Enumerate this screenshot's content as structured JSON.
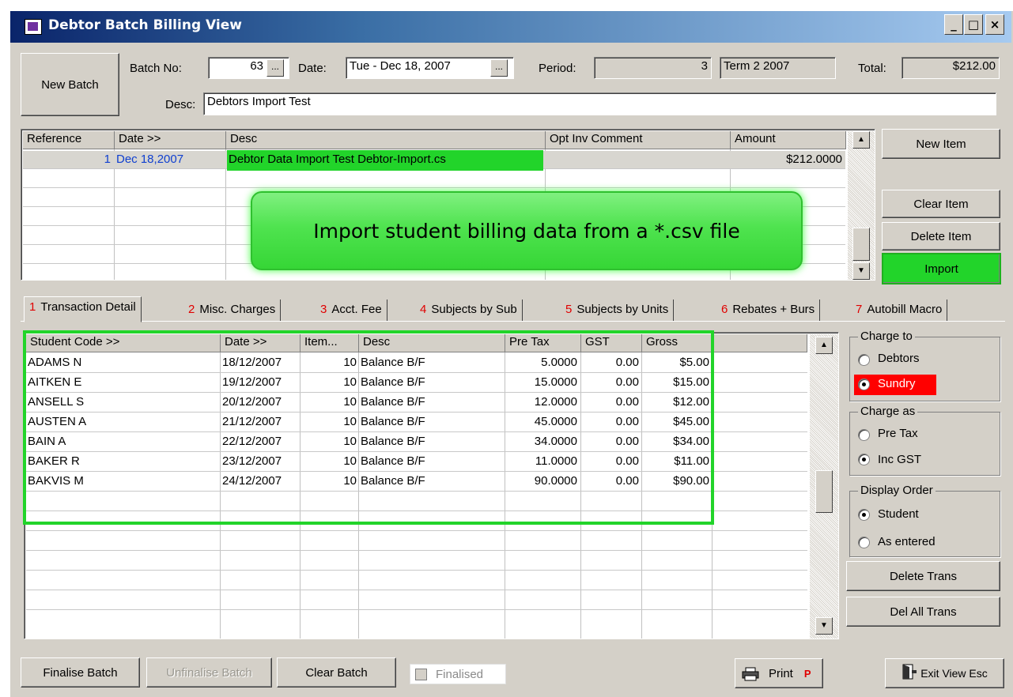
{
  "window": {
    "title": "Debtor Batch Billing View",
    "controls": {
      "minimize": "_",
      "maximize": "□",
      "close": "×"
    }
  },
  "header": {
    "new_batch_label": "New Batch",
    "batch_no_label": "Batch No:",
    "batch_no_value": "63",
    "ellipsis": "...",
    "date_label": "Date:",
    "date_value": "Tue - Dec 18, 2007",
    "period_label": "Period:",
    "period_value": "3",
    "term_value": "Term 2 2007",
    "total_label": "Total:",
    "total_value": "$212.00",
    "desc_label": "Desc:",
    "desc_value": "Debtors Import Test"
  },
  "items_grid": {
    "columns": [
      "Reference",
      "Date >>",
      "Desc",
      "Opt Inv Comment",
      "Amount"
    ],
    "rows": [
      {
        "reference": "1",
        "date": "Dec 18,2007",
        "desc": "Debtor Data Import Test Debtor-Import.cs",
        "comment": "",
        "amount": "$212.0000"
      }
    ]
  },
  "item_buttons": {
    "new_item": "New Item",
    "clear_item": "Clear Item",
    "delete_item": "Delete Item",
    "import": "Import"
  },
  "callout": "Import student billing data from a *.csv file",
  "tabs": [
    {
      "num": "1",
      "label": "Transaction Detail"
    },
    {
      "num": "2",
      "label": "Misc. Charges"
    },
    {
      "num": "3",
      "label": "Acct. Fee"
    },
    {
      "num": "4",
      "label": "Subjects by Sub"
    },
    {
      "num": "5",
      "label": "Subjects by Units"
    },
    {
      "num": "6",
      "label": "Rebates + Burs"
    },
    {
      "num": "7",
      "label": "Autobill Macro"
    }
  ],
  "trans_grid": {
    "columns": [
      "Student Code >>",
      "Date >>",
      "Item...",
      "Desc",
      "Pre Tax",
      "GST",
      "Gross"
    ],
    "rows": [
      {
        "code": "ADAMS N",
        "date": "18/12/2007",
        "item": "10",
        "desc": "Balance B/F",
        "pretax": "5.0000",
        "gst": "0.00",
        "gross": "$5.00"
      },
      {
        "code": "AITKEN E",
        "date": "19/12/2007",
        "item": "10",
        "desc": "Balance B/F",
        "pretax": "15.0000",
        "gst": "0.00",
        "gross": "$15.00"
      },
      {
        "code": "ANSELL S",
        "date": "20/12/2007",
        "item": "10",
        "desc": "Balance B/F",
        "pretax": "12.0000",
        "gst": "0.00",
        "gross": "$12.00"
      },
      {
        "code": "AUSTEN A",
        "date": "21/12/2007",
        "item": "10",
        "desc": "Balance B/F",
        "pretax": "45.0000",
        "gst": "0.00",
        "gross": "$45.00"
      },
      {
        "code": "BAIN A",
        "date": "22/12/2007",
        "item": "10",
        "desc": "Balance B/F",
        "pretax": "34.0000",
        "gst": "0.00",
        "gross": "$34.00"
      },
      {
        "code": "BAKER R",
        "date": "23/12/2007",
        "item": "10",
        "desc": "Balance B/F",
        "pretax": "11.0000",
        "gst": "0.00",
        "gross": "$11.00"
      },
      {
        "code": "BAKVIS M",
        "date": "24/12/2007",
        "item": "10",
        "desc": "Balance B/F",
        "pretax": "90.0000",
        "gst": "0.00",
        "gross": "$90.00"
      }
    ]
  },
  "options": {
    "charge_to": {
      "title": "Charge to",
      "debtors": "Debtors",
      "sundry": "Sundry",
      "selected": "Sundry"
    },
    "charge_as": {
      "title": "Charge as",
      "pre_tax": "Pre Tax",
      "inc_gst": "Inc GST",
      "selected": "Inc GST"
    },
    "display_order": {
      "title": "Display Order",
      "student": "Student",
      "as_entered": "As entered",
      "selected": "Student"
    },
    "delete_trans": "Delete Trans",
    "del_all_trans": "Del All Trans"
  },
  "footer": {
    "finalise": "Finalise Batch",
    "unfinalise": "Unfinalise Batch",
    "clear_batch": "Clear Batch",
    "finalised_label": "Finalised",
    "finalised_checked": false,
    "print": "Print",
    "print_key": "P",
    "exit": "Exit View Esc"
  },
  "colors": {
    "highlight": "#22d42a",
    "sundry_bg": "#ff0000",
    "tab_number": "#e00000",
    "link": "#1040d0"
  }
}
